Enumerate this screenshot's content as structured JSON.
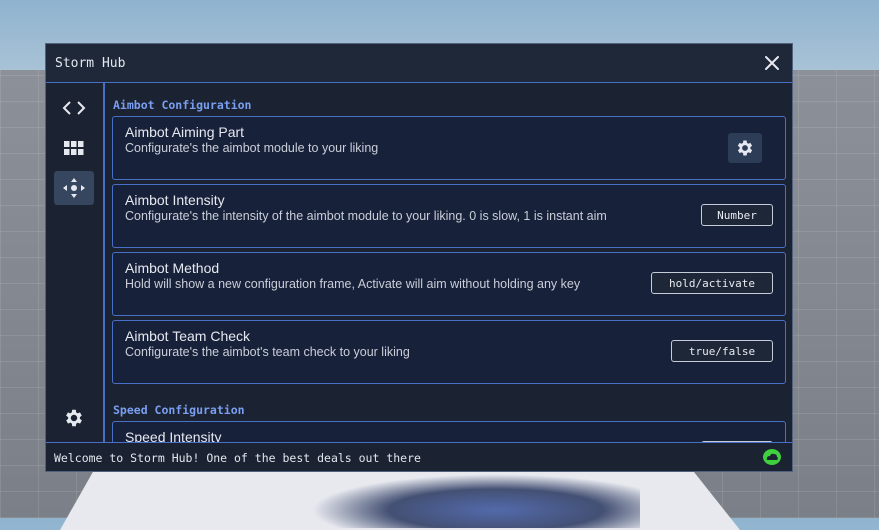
{
  "window": {
    "title": "Storm Hub",
    "status_text": "Welcome to Storm Hub! One of the best deals out there"
  },
  "sidebar": {
    "items": [
      {
        "icon": "code-icon",
        "active": false
      },
      {
        "icon": "grid-icon",
        "active": false
      },
      {
        "icon": "move-icon",
        "active": true
      },
      {
        "icon": "settings-icon",
        "active": false
      }
    ]
  },
  "sections": [
    {
      "title": "Aimbot Configuration",
      "cards": [
        {
          "title": "Aimbot Aiming Part",
          "description": "Configurate's the aimbot module to your liking",
          "control": "gear"
        },
        {
          "title": "Aimbot Intensity",
          "description": "Configurate's the intensity of the aimbot module to your liking. 0 is slow, 1 is instant aim",
          "control": "Number"
        },
        {
          "title": "Aimbot Method",
          "description": "Hold will show a new configuration frame, Activate will aim without holding any key",
          "control": "hold/activate"
        },
        {
          "title": "Aimbot Team Check",
          "description": "Configurate's the aimbot's team check to your liking",
          "control": "true/false"
        }
      ]
    },
    {
      "title": "Speed Configuration",
      "cards": [
        {
          "title": "Speed Intensity",
          "description": "",
          "control": ""
        }
      ]
    }
  ],
  "colors": {
    "accent": "#4a6fc6",
    "section_title": "#7a9ef0",
    "status_icon": "#3fcf3f",
    "window_bg": "#1b2332"
  }
}
